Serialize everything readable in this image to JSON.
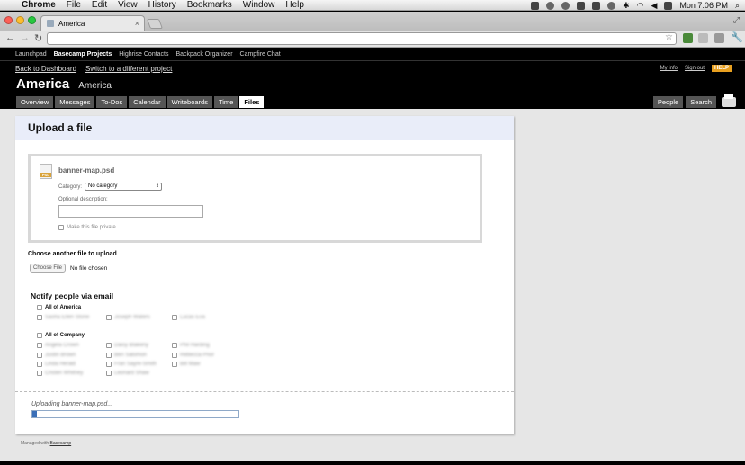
{
  "menubar": {
    "app": "Chrome",
    "items": [
      "File",
      "Edit",
      "View",
      "History",
      "Bookmarks",
      "Window",
      "Help"
    ],
    "clock": "Mon 7:06 PM"
  },
  "browser": {
    "tab_title": "America",
    "tab_close": "×"
  },
  "basecamp": {
    "apps": [
      "Launchpad",
      "Basecamp Projects",
      "Highrise Contacts",
      "Backpack Organizer",
      "Campfire Chat"
    ],
    "back_link": "Back to Dashboard",
    "switch_link": "Switch to a different project",
    "my_info": "My info",
    "sign_out": "Sign out",
    "help": "HELP",
    "project_name": "America",
    "company_name": "America",
    "tabs": [
      "Overview",
      "Messages",
      "To-Dos",
      "Calendar",
      "Writeboards",
      "Time",
      "Files"
    ],
    "active_tab": "Files",
    "right_tabs": [
      "People",
      "Search"
    ]
  },
  "upload": {
    "title": "Upload a file",
    "file_name": "banner-map.psd",
    "file_icon_label": "PSD",
    "category_label": "Category:",
    "category_value": "No category",
    "description_label": "Optional description:",
    "private_label": "Make this file private",
    "another_label": "Choose another file to upload",
    "choose_button": "Choose File",
    "no_file": "No file chosen",
    "notify_title": "Notify people via email",
    "group_all_project": "All of  America",
    "group_all_company": "All of Company",
    "project_people": [
      "Sasha Ellen Stone",
      "Joseph Waters",
      "Lucas Eva"
    ],
    "company_people": [
      "Angela Crown",
      "Daisy Blakeny",
      "Phil Harding",
      "Justin Brown",
      "Ben Salomon",
      "Rebecca Prior",
      "Linda Herald",
      "Fran Sayre-Smith",
      "Bill Maw",
      "Cristen Whitney",
      "Leonard Shaw"
    ],
    "uploading_text": "Uploading banner-map.psd...",
    "progress_percent": 2
  },
  "footer": {
    "prefix": "Managed with",
    "link": "Basecamp"
  }
}
